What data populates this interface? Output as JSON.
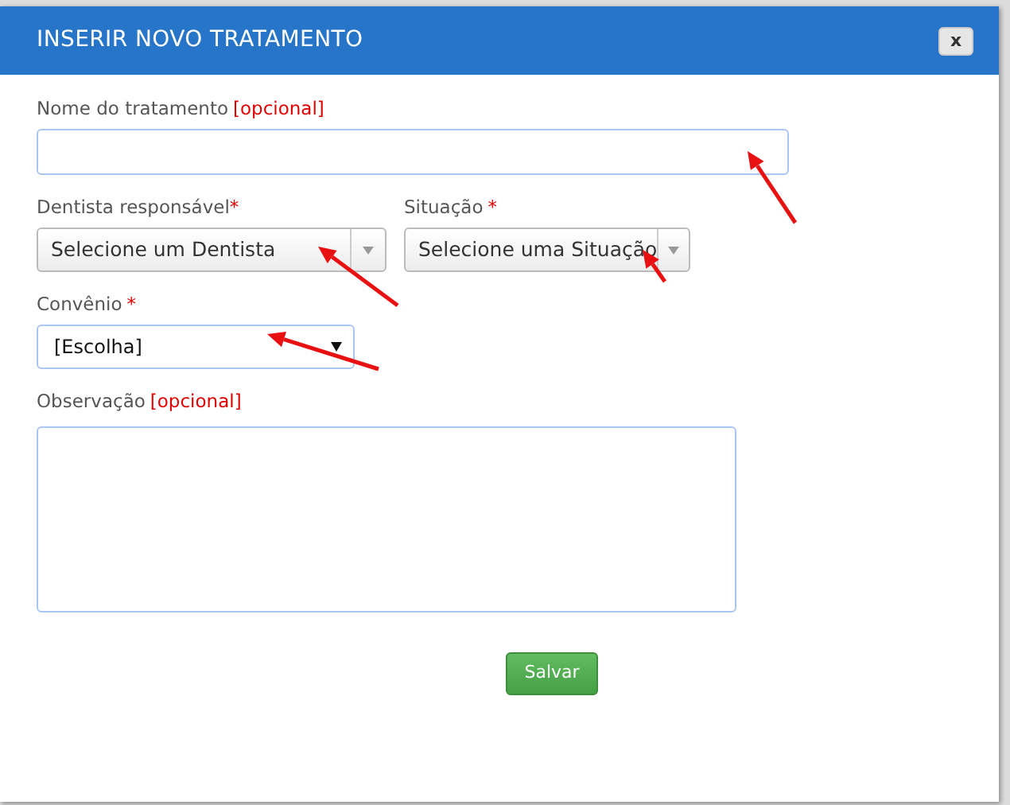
{
  "dialog": {
    "title": "INSERIR NOVO TRATAMENTO",
    "close_button": "x"
  },
  "fields": [
    {
      "kind": "input",
      "label": "Nome do tratamento",
      "marker": "[opcional]"
    },
    {
      "kind": "select",
      "label": "Dentista responsável",
      "marker": "*",
      "value": "Selecione um Dentista"
    },
    {
      "kind": "select",
      "label": "Situação",
      "marker": "*",
      "value": "Selecione uma Situação"
    },
    {
      "kind": "native-select",
      "label": "Convênio",
      "marker": "*",
      "value": "[Escolha]"
    },
    {
      "kind": "textarea",
      "label": "Observação",
      "marker": "[opcional]"
    }
  ],
  "submit_button": "Salvar"
}
